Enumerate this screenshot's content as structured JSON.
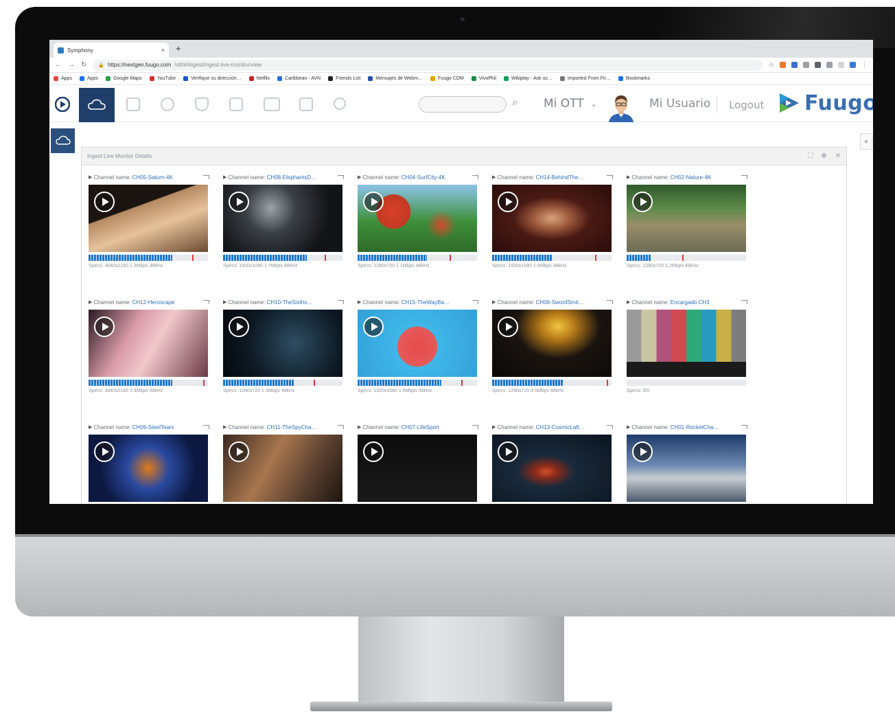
{
  "browser": {
    "tab_title": "Symphony",
    "tab_close": "×",
    "new_tab": "+",
    "url_host": "https://nextgen.fuugo.com",
    "url_path": "/ott/#/ingest/ingest-live-monitor/view",
    "bookmarks": [
      "Apps",
      "Apps",
      "Google Maps",
      "YouTube",
      "Verifique su dirección…",
      "Netflix",
      "Caribbean - AVN",
      "Friends List",
      "Mensajes de Webm…",
      "Fuugo CDM",
      "VivoPhil",
      "Wikiplay - Ask us…",
      "Imported From Fir…",
      "Bookmarks"
    ]
  },
  "header": {
    "ott_label": "Mi OTT",
    "user_label": "Mi Usuario",
    "logout_label": "Logout",
    "brand": "Fuugo",
    "brand_color": "#3a6fb1",
    "active_nav_color": "#1f3f6a"
  },
  "panel": {
    "title": "Ingest Live Monitor Details"
  },
  "channels": [
    {
      "name": "CH05-Saturn-4K",
      "specs": "Specs: 3840x2160 1.3Mbps 48kHz",
      "fill": 0.7,
      "mark": 0.88
    },
    {
      "name": "CH08-ElephantsD…",
      "specs": "Specs: 1920x1080 1.7Mbps 48kHz",
      "fill": 0.7,
      "mark": 0.86
    },
    {
      "name": "CH04-SurfCity-4K",
      "specs": "Specs: 1280x720 1.1Mbps 48kHz",
      "fill": 0.58,
      "mark": 0.78
    },
    {
      "name": "CH14-BehindThe…",
      "specs": "Specs: 1920x1080 1.5Mbps 48kHz",
      "fill": 0.5,
      "mark": 0.87
    },
    {
      "name": "CH02-Nature-4K",
      "specs": "Specs: 1280x720 1.2Mbps 48kHz",
      "fill": 0.2,
      "mark": 0.47
    },
    {
      "name": "CH12-Heroscape",
      "specs": "Specs: 3840x2160 3.4Mbps 48kHz",
      "fill": 0.7,
      "mark": 0.97
    },
    {
      "name": "CH10-TheSixths…",
      "specs": "Specs: 1280x720 1.3Mbps 48kHz",
      "fill": 0.6,
      "mark": 0.77
    },
    {
      "name": "CH15-TheWayBa…",
      "specs": "Specs: 1920x1080 1.5Mbps 48kHz",
      "fill": 0.7,
      "mark": 0.88
    },
    {
      "name": "CH06-SwordSmit…",
      "specs": "Specs: 1280x720 4.5Mbps 48kHz",
      "fill": 0.6,
      "mark": 0.97
    },
    {
      "name": "Encargado CH3",
      "specs": "Specs: 0/0",
      "fill": 0,
      "mark": -1
    },
    {
      "name": "CH09-SteelTears",
      "specs": "",
      "fill": 0,
      "mark": -1
    },
    {
      "name": "CH11-TheSpyCha…",
      "specs": "",
      "fill": 0,
      "mark": -1
    },
    {
      "name": "CH07-LifeSport",
      "specs": "",
      "fill": 0,
      "mark": -1
    },
    {
      "name": "CH13-CosmicLaft…",
      "specs": "",
      "fill": 0,
      "mark": -1
    },
    {
      "name": "CH01-RocketCha…",
      "specs": "",
      "fill": 0,
      "mark": -1
    }
  ],
  "channel_label": "Channel name:"
}
